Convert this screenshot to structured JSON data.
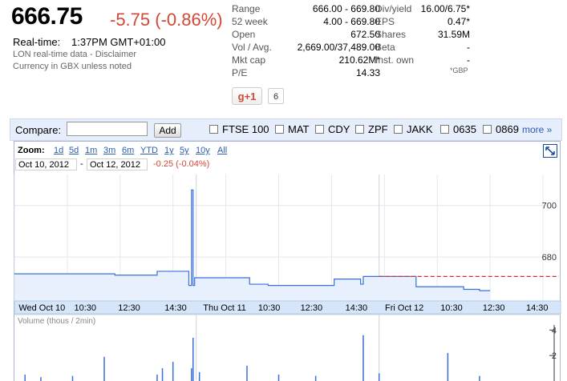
{
  "quote": {
    "price": "666.75",
    "change": "-5.75 (-0.86%)",
    "realtime_label": "Real-time:",
    "realtime_time": "1:37PM GMT+01:00",
    "lon_note": "LON real-time data - Disclaimer",
    "currency_note": "Currency in GBX unless noted"
  },
  "stats_left": [
    {
      "label": "Range",
      "value": "666.00 - 669.80"
    },
    {
      "label": "52 week",
      "value": "4.00 - 669.80"
    },
    {
      "label": "Open",
      "value": "672.50"
    },
    {
      "label": "Vol / Avg.",
      "value": "2,669.00/37,489.00"
    },
    {
      "label": "Mkt cap",
      "value": "210.62M*"
    },
    {
      "label": "P/E",
      "value": "14.33"
    }
  ],
  "stats_right": [
    {
      "label": "Div/yield",
      "value": "16.00/6.75*"
    },
    {
      "label": "EPS",
      "value": "0.47*"
    },
    {
      "label": "Shares",
      "value": "31.59M"
    },
    {
      "label": "Beta",
      "value": "-"
    },
    {
      "label": "Inst. own",
      "value": "-"
    }
  ],
  "gbp_note": "*GBP",
  "plusone": {
    "label": "+1",
    "count": "6"
  },
  "compare": {
    "label": "Compare:",
    "input_value": "",
    "add_label": "Add",
    "items": [
      "FTSE 100",
      "MAT",
      "CDY",
      "ZPF",
      "JAKK",
      "0635",
      "0869"
    ],
    "more_label": "more »"
  },
  "zoom": {
    "label": "Zoom:",
    "options": [
      "1d",
      "5d",
      "1m",
      "3m",
      "6m",
      "YTD",
      "1y",
      "5y",
      "10y",
      "All"
    ]
  },
  "range": {
    "from": "Oct 10, 2012",
    "dash": "-",
    "to": "Oct 12, 2012",
    "change": "-0.25 (-0.04%)"
  },
  "volume_label": "Volume (thous / 2min)",
  "colors": {
    "down": "#d14836",
    "link": "#2a5db0",
    "price_line": "#3a6fd8",
    "price_fill": "#e8f0fd",
    "prev_close": "#cc3333",
    "axis_band": "#d6e6fa"
  },
  "chart_data": {
    "type": "line",
    "title": "",
    "xlabel": "",
    "ylabel": "",
    "ylim": [
      663,
      712
    ],
    "y_ticks": [
      700,
      680
    ],
    "x_ticks": [
      "Wed Oct 10",
      "10:30",
      "12:30",
      "14:30",
      "Thu Oct 11",
      "10:30",
      "12:30",
      "14:30",
      "Fri Oct 12",
      "10:30",
      "12:30",
      "14:30"
    ],
    "previous_close": 672.5,
    "series": [
      {
        "x": [
          0,
          0.16,
          0.19,
          0.27,
          0.305,
          0.33,
          0.335,
          0.338,
          0.341,
          0.36,
          0.44,
          0.445,
          0.48,
          0.6,
          0.605,
          0.64,
          0.655,
          0.66,
          0.7,
          0.75,
          0.76,
          0.85,
          0.88,
          0.9
        ],
        "y": [
          673.5,
          673.5,
          673,
          674.5,
          674.5,
          669,
          706,
          669,
          672,
          672,
          672,
          669.5,
          669,
          669,
          671.5,
          671.5,
          669.5,
          672.5,
          672.5,
          672.5,
          668.5,
          667.5,
          667,
          667
        ]
      }
    ],
    "volume": {
      "ylim": [
        0,
        4.4
      ],
      "y_ticks": [
        4,
        2
      ],
      "x": [
        0.02,
        0.05,
        0.11,
        0.17,
        0.27,
        0.28,
        0.3,
        0.335,
        0.338,
        0.35,
        0.44,
        0.5,
        0.57,
        0.66,
        0.69,
        0.82,
        0.88
      ],
      "values": [
        0.5,
        0.3,
        0.4,
        1.9,
        0.5,
        1.0,
        1.5,
        1.0,
        3.4,
        0.7,
        1.2,
        0.5,
        0.4,
        3.6,
        0.6,
        2.2,
        0.4
      ]
    }
  }
}
